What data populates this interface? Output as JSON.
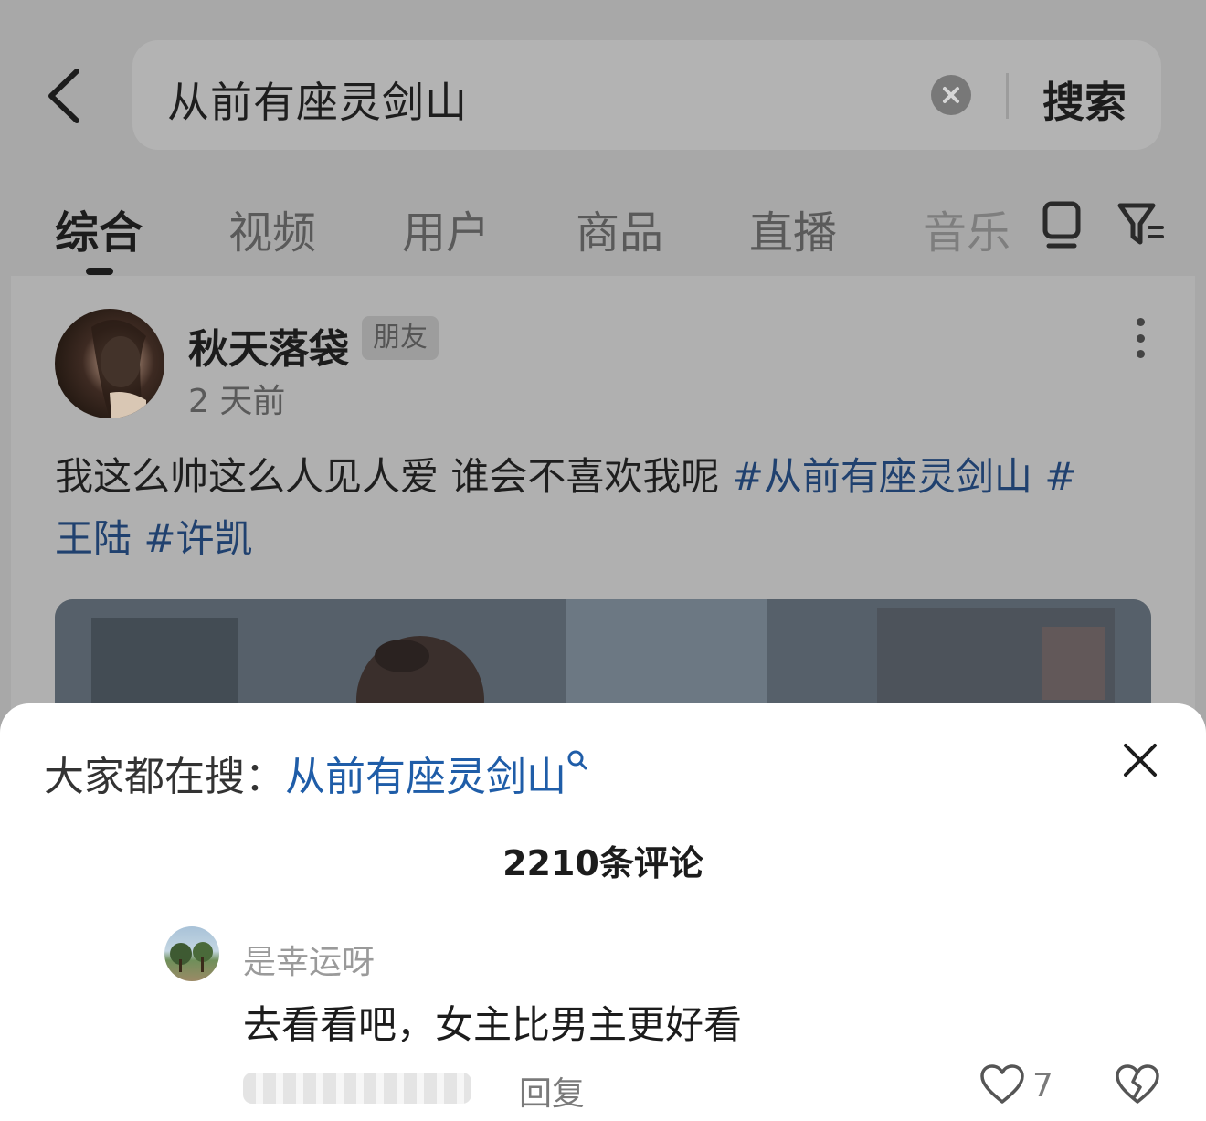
{
  "search": {
    "query": "从前有座灵剑山",
    "submit_label": "搜索"
  },
  "tabs": [
    {
      "label": "综合",
      "active": true
    },
    {
      "label": "视频"
    },
    {
      "label": "用户"
    },
    {
      "label": "商品"
    },
    {
      "label": "直播"
    },
    {
      "label": "音乐"
    }
  ],
  "post": {
    "username": "秋天落袋",
    "badge": "朋友",
    "time": "2 天前",
    "text": "我这么帅这么人见人爱 谁会不喜欢我呢 ",
    "hashtags": [
      "#从前有座灵剑山 #",
      "王陆 #许凯"
    ]
  },
  "sheet": {
    "prefix": "大家都在搜：",
    "search_term": "从前有座灵剑山",
    "comment_count": "2210条评论"
  },
  "comment": {
    "username": "是幸运呀",
    "text": "去看看吧，女主比男主更好看",
    "reply_label": "回复",
    "likes": "7"
  },
  "colors": {
    "link": "#20416f",
    "sheet_link": "#1f5da8",
    "overlay": "#a8a8a8"
  },
  "icons": [
    "back-arrow-icon",
    "clear-icon",
    "grid-view-icon",
    "filter-icon",
    "more-icon",
    "search-icon",
    "close-icon",
    "heart-icon",
    "broken-heart-icon"
  ]
}
